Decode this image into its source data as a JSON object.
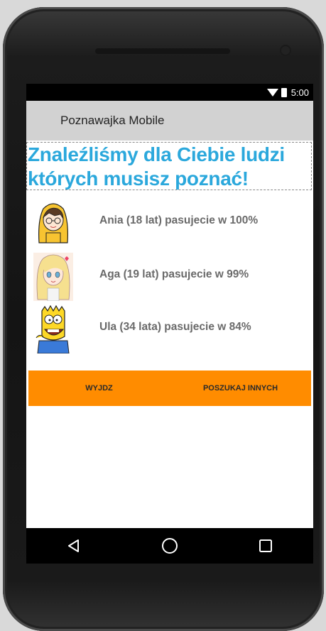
{
  "status_bar": {
    "time": "5:00",
    "icons": [
      "wifi-icon",
      "battery-icon"
    ]
  },
  "action_bar": {
    "title": "Poznawajka Mobile"
  },
  "heading": {
    "line1": "Znaleźliśmy dla Ciebie ludzi",
    "line2": "których musisz poznać!",
    "color": "#2ba8dc"
  },
  "people": [
    {
      "avatar": "girl-yellow-hood-avatar",
      "label": "Ania (18 lat) pasujecie w 100%"
    },
    {
      "avatar": "girl-blonde-avatar",
      "label": "Aga (19 lat) pasujecie w 99%"
    },
    {
      "avatar": "bart-simpson-avatar",
      "label": "Ula (34 lata) pasujecie w 84%"
    }
  ],
  "buttons": {
    "exit_label": "WYJDZ",
    "search_label": "POSZUKAJ INNYCH",
    "color": "#ff8c00"
  },
  "nav": {
    "back": "back-icon",
    "home": "home-icon",
    "recents": "recents-icon"
  }
}
